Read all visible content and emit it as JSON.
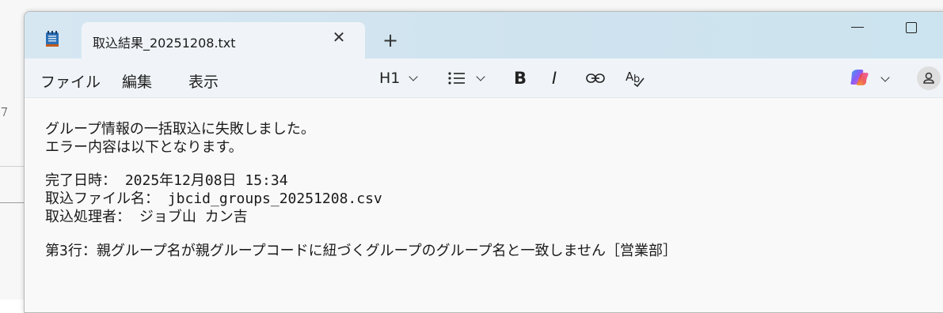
{
  "tab": {
    "title": "取込結果_20251208.txt",
    "close_icon": "close-icon",
    "new_tab_icon": "plus-icon"
  },
  "window_controls": {
    "minimize_icon": "minimize-icon",
    "maximize_icon": "maximize-icon"
  },
  "menu": {
    "file": "ファイル",
    "edit": "編集",
    "view": "表示"
  },
  "toolbar": {
    "heading": "H1",
    "list_icon": "list-icon",
    "bold": "B",
    "italic": "I",
    "link_icon": "link-icon",
    "spellcheck_icon": "spellcheck-icon",
    "copilot_icon": "copilot-icon",
    "account_icon": "account-icon"
  },
  "colors": {
    "titlebar": "#cfe3ef",
    "toolbar": "#f0f4f8",
    "editor": "#f9f9f9"
  },
  "content": {
    "lines": [
      "グループ情報の一括取込に失敗しました。",
      "エラー内容は以下となります。",
      "",
      "完了日時： 2025年12月08日 15:34",
      "取込ファイル名： jbcid_groups_20251208.csv",
      "取込処理者： ジョブ山 カン吉",
      "",
      "第3行：親グループ名が親グループコードに紐づくグループのグループ名と一致しません［営業部］"
    ]
  }
}
